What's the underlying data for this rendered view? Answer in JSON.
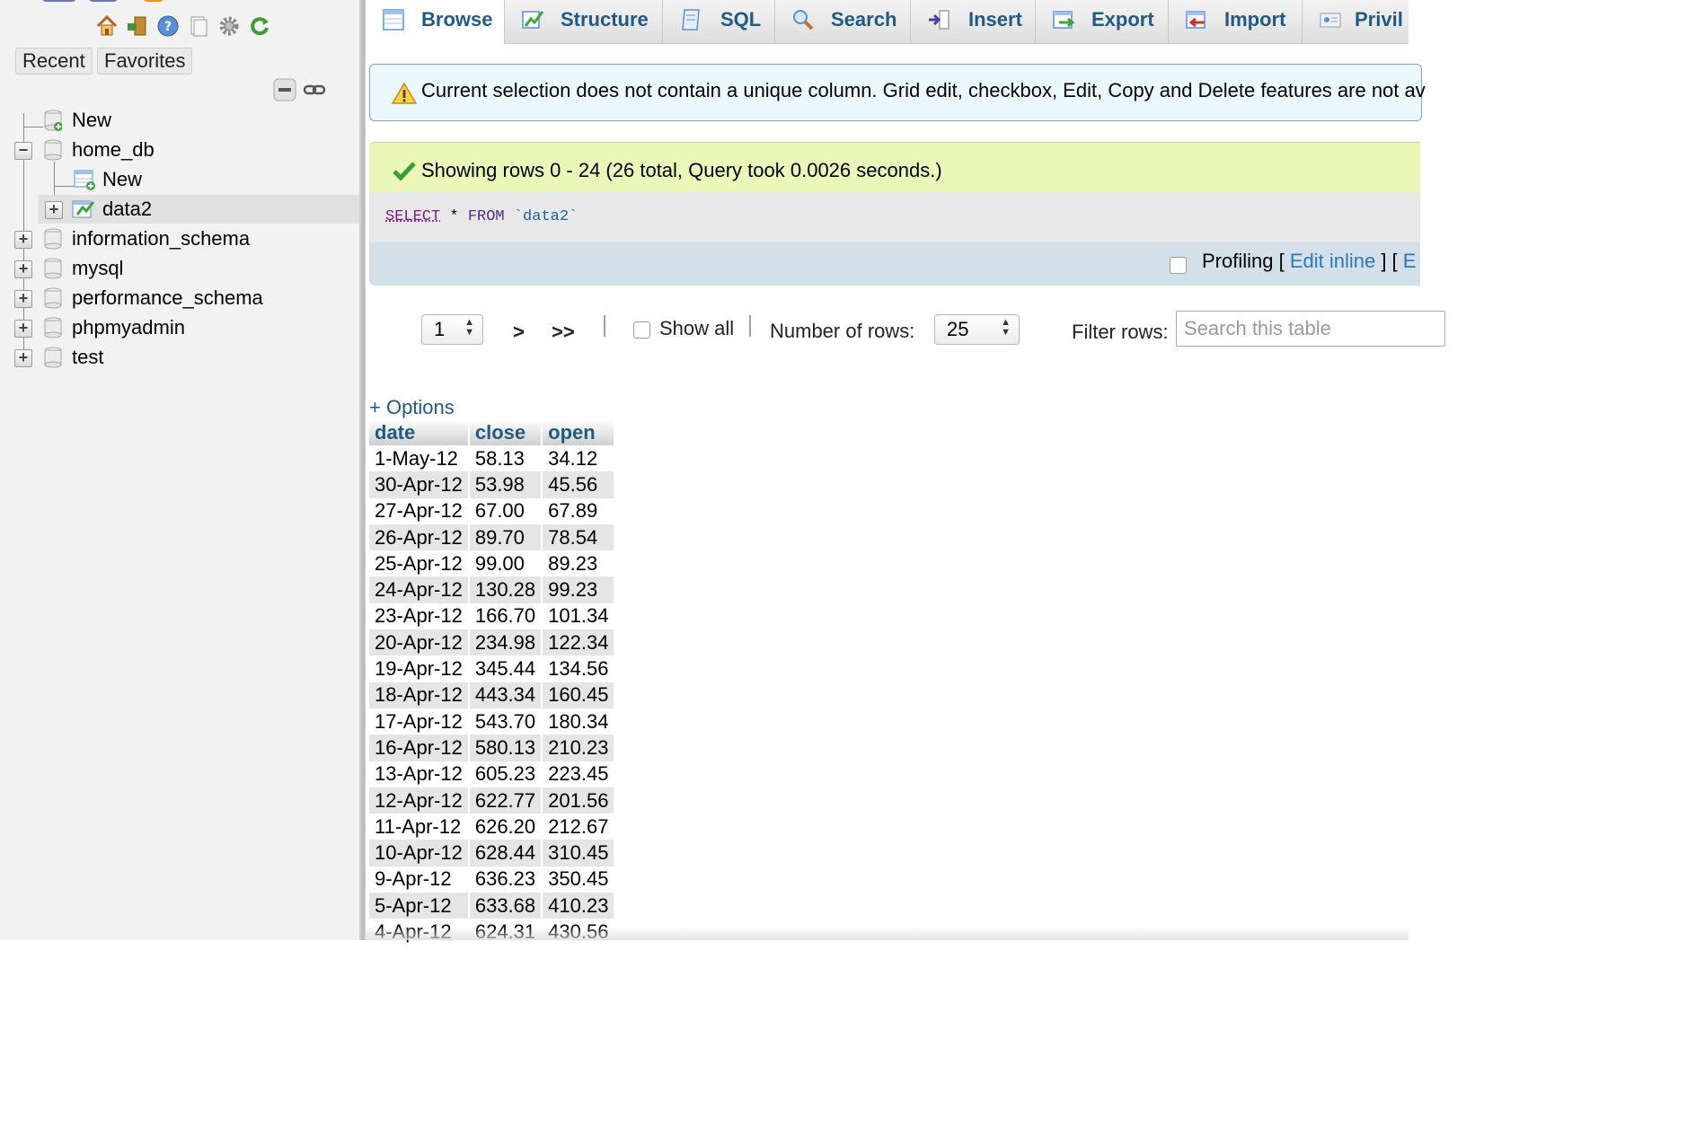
{
  "nav": {
    "recent_label": "Recent",
    "favorites_label": "Favorites",
    "tree": [
      {
        "label": "New",
        "kind": "new-db"
      },
      {
        "label": "home_db",
        "kind": "database",
        "expanded": true
      },
      {
        "label": "New",
        "kind": "new-table"
      },
      {
        "label": "data2",
        "kind": "table",
        "selected": true
      },
      {
        "label": "information_schema",
        "kind": "database"
      },
      {
        "label": "mysql",
        "kind": "database"
      },
      {
        "label": "performance_schema",
        "kind": "database"
      },
      {
        "label": "phpmyadmin",
        "kind": "database"
      },
      {
        "label": "test",
        "kind": "database"
      }
    ]
  },
  "tabs": [
    {
      "label": "Browse",
      "icon": "browse-icon",
      "active": true
    },
    {
      "label": "Structure",
      "icon": "structure-icon"
    },
    {
      "label": "SQL",
      "icon": "sql-icon"
    },
    {
      "label": "Search",
      "icon": "search-icon"
    },
    {
      "label": "Insert",
      "icon": "insert-icon"
    },
    {
      "label": "Export",
      "icon": "export-icon"
    },
    {
      "label": "Import",
      "icon": "import-icon"
    },
    {
      "label": "Privil",
      "icon": "privileges-icon"
    }
  ],
  "messages": {
    "warning": "Current selection does not contain a unique column. Grid edit, checkbox, Edit, Copy and Delete features are not av",
    "success": "Showing rows 0 - 24 (26 total, Query took 0.0026 seconds.)"
  },
  "sql": {
    "select": "SELECT",
    "star": " * ",
    "from": "FROM",
    "table": " `data2`"
  },
  "profiling": {
    "label": "Profiling",
    "open_bracket": " [ ",
    "edit_inline": "Edit inline",
    "close_open": " ] [ ",
    "truncated": "E"
  },
  "pager": {
    "page": "1",
    "next": ">",
    "last": ">>",
    "show_all": "Show all",
    "rows_label": "Number of rows:",
    "rows_value": "25",
    "filter_label": "Filter rows:",
    "filter_placeholder": "Search this table"
  },
  "options_label": "+ Options",
  "table": {
    "columns": [
      "date",
      "close",
      "open"
    ],
    "rows": [
      [
        "1-May-12",
        "58.13",
        "34.12"
      ],
      [
        "30-Apr-12",
        "53.98",
        "45.56"
      ],
      [
        "27-Apr-12",
        "67.00",
        "67.89"
      ],
      [
        "26-Apr-12",
        "89.70",
        "78.54"
      ],
      [
        "25-Apr-12",
        "99.00",
        "89.23"
      ],
      [
        "24-Apr-12",
        "130.28",
        "99.23"
      ],
      [
        "23-Apr-12",
        "166.70",
        "101.34"
      ],
      [
        "20-Apr-12",
        "234.98",
        "122.34"
      ],
      [
        "19-Apr-12",
        "345.44",
        "134.56"
      ],
      [
        "18-Apr-12",
        "443.34",
        "160.45"
      ],
      [
        "17-Apr-12",
        "543.70",
        "180.34"
      ],
      [
        "16-Apr-12",
        "580.13",
        "210.23"
      ],
      [
        "13-Apr-12",
        "605.23",
        "223.45"
      ],
      [
        "12-Apr-12",
        "622.77",
        "201.56"
      ],
      [
        "11-Apr-12",
        "626.20",
        "212.67"
      ],
      [
        "10-Apr-12",
        "628.44",
        "310.45"
      ],
      [
        "9-Apr-12",
        "636.23",
        "350.45"
      ],
      [
        "5-Apr-12",
        "633.68",
        "410.23"
      ],
      [
        "4-Apr-12",
        "624.31",
        "430.56"
      ]
    ]
  },
  "colors": {
    "link": "#235a81",
    "warning_bg": "#ebf8fd",
    "success_bg": "#ebf7b8",
    "nav_bg": "#f2f2f2"
  }
}
